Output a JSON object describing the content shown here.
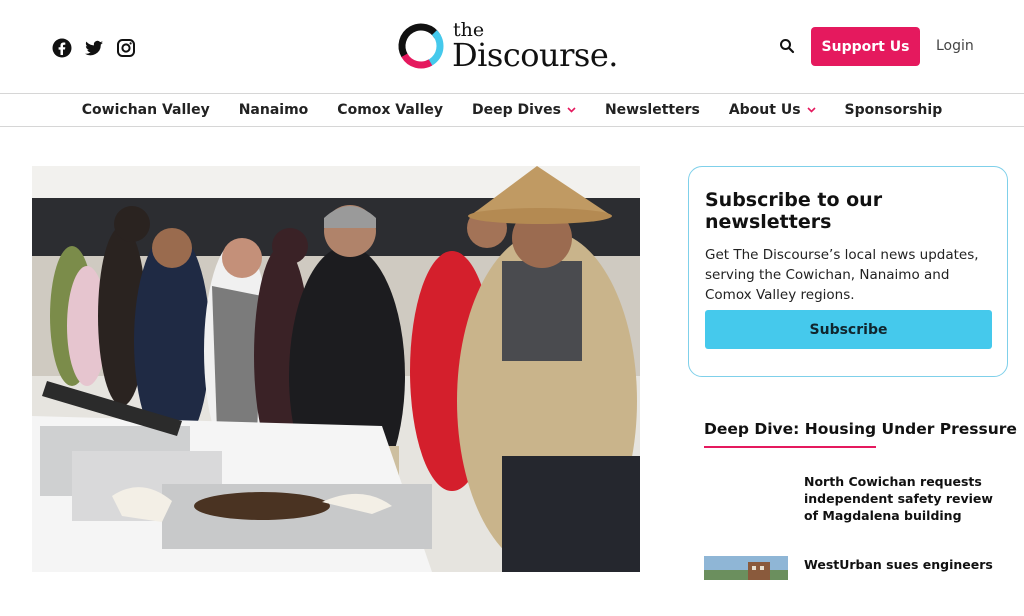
{
  "header": {
    "social": [
      {
        "icon": "facebook-icon"
      },
      {
        "icon": "twitter-icon"
      },
      {
        "icon": "instagram-icon"
      }
    ],
    "logo": {
      "small": "the",
      "large": "Discourse."
    },
    "support_label": "Support Us",
    "login_label": "Login"
  },
  "nav": {
    "items": [
      {
        "label": "Cowichan Valley",
        "dropdown": false
      },
      {
        "label": "Nanaimo",
        "dropdown": false
      },
      {
        "label": "Comox Valley",
        "dropdown": false
      },
      {
        "label": "Deep Dives",
        "dropdown": true
      },
      {
        "label": "Newsletters",
        "dropdown": false
      },
      {
        "label": "About Us",
        "dropdown": true
      },
      {
        "label": "Sponsorship",
        "dropdown": false
      }
    ]
  },
  "newsletter": {
    "title": "Subscribe to our newsletters",
    "body": "Get The Discourse’s local news updates, serving the Cowichan, Nanaimo and Comox Valley regions.",
    "button_label": "Subscribe"
  },
  "sidebar": {
    "section_title": "Deep Dive: Housing Under Pressure",
    "articles": [
      {
        "headline": "North Cowichan requests independent safety review of Magdalena building"
      },
      {
        "headline": "WestUrban sues engineers"
      }
    ]
  },
  "colors": {
    "brand_pink": "#e5195e",
    "brand_blue": "#45c9ec",
    "logo_black": "#111111"
  }
}
